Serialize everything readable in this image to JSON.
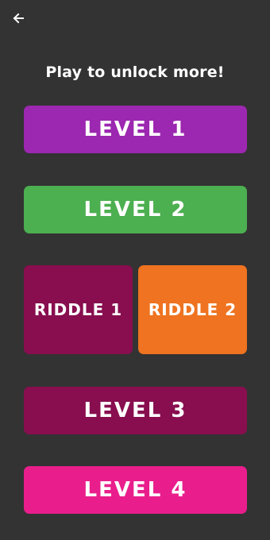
{
  "header": {
    "back_icon": "arrow-left-icon",
    "subtitle": "Play to unlock more!"
  },
  "buttons": {
    "level1": {
      "label": "LEVEL 1",
      "color": "#9C27B0"
    },
    "level2": {
      "label": "LEVEL 2",
      "color": "#4CAF50"
    },
    "riddle1": {
      "label": "RIDDLE 1",
      "color": "#880E4F"
    },
    "riddle2": {
      "label": "RIDDLE 2",
      "color": "#EF7320"
    },
    "level3": {
      "label": "LEVEL 3",
      "color": "#880E4F"
    },
    "level4": {
      "label": "LEVEL 4",
      "color": "#E91E8C"
    }
  },
  "colors": {
    "background": "#333333",
    "text": "#FFFFFF"
  }
}
